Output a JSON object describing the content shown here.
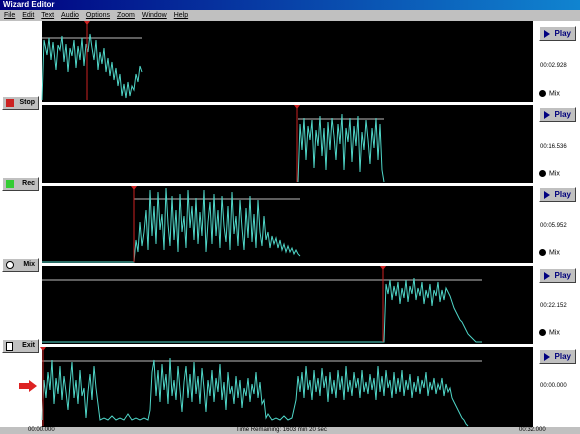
{
  "window": {
    "title": "Wizard Editor"
  },
  "menu": [
    "File",
    "Edit",
    "Text",
    "Audio",
    "Options",
    "Zoom",
    "Window",
    "Help"
  ],
  "side_buttons": {
    "stop": "Stop",
    "rec": "Rec",
    "mix": "Mix",
    "exit": "Exit"
  },
  "tracks": [
    {
      "play": "Play",
      "time": "00:02.928",
      "mix": "Mix"
    },
    {
      "play": "Play",
      "time": "00:16.536",
      "mix": "Mix"
    },
    {
      "play": "Play",
      "time": "00:05.952",
      "mix": "Mix"
    },
    {
      "play": "Play",
      "time": "00:22.152",
      "mix": "Mix"
    },
    {
      "play": "Play",
      "time": "00:00.000",
      "mix": ""
    }
  ],
  "status": {
    "start_time": "00:00.000",
    "remaining": "Time Remaining: 1603 min 20 sec",
    "end_time": "00:32.000"
  },
  "colors": {
    "waveform": "#4fd6c8",
    "marker": "#cc2222",
    "track_bg": "#000000",
    "title_bar": "#000080"
  }
}
